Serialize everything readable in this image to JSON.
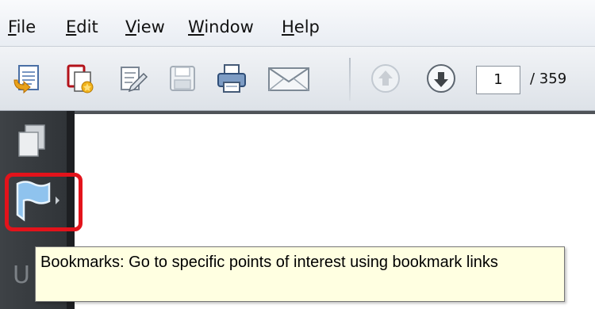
{
  "menubar": {
    "items": [
      {
        "label_ul": "F",
        "label_rest": "ile"
      },
      {
        "label_ul": "E",
        "label_rest": "dit"
      },
      {
        "label_ul": "V",
        "label_rest": "iew"
      },
      {
        "label_ul": "W",
        "label_rest": "indow"
      },
      {
        "label_ul": "H",
        "label_rest": "elp"
      }
    ]
  },
  "toolbar": {
    "icons": [
      "create-pdf-icon",
      "combine-files-icon",
      "edit-document-icon",
      "save-icon",
      "print-icon",
      "email-icon",
      "previous-page-icon",
      "next-page-icon"
    ],
    "page_current": "1",
    "page_total": "/ 359"
  },
  "navpanel": {
    "icons": [
      "pages-icon",
      "bookmarks-icon"
    ],
    "partial_glyph": "U"
  },
  "tooltip": {
    "text": "Bookmarks: Go to specific points of interest using bookmark links"
  },
  "colors": {
    "highlight": "#e3131b",
    "tooltip_bg": "#ffffe1",
    "navpanel_bg": "#3e4246"
  }
}
